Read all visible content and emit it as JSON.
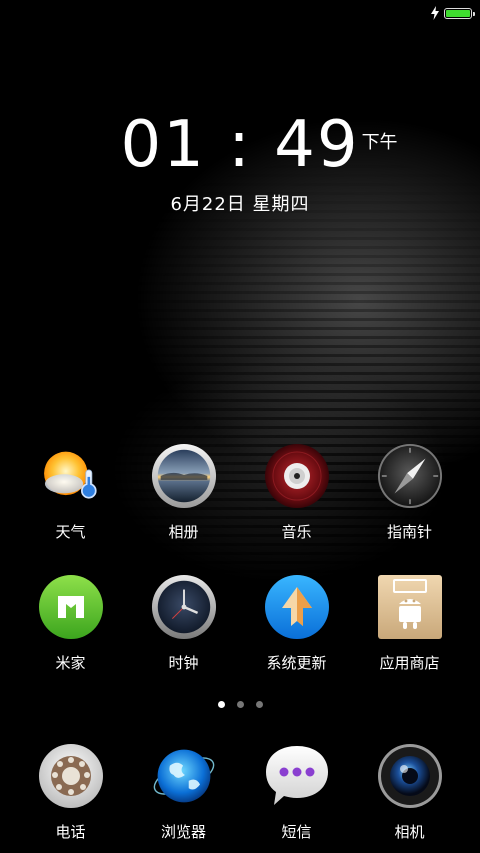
{
  "status_bar": {
    "battery_level": 1.0,
    "charging": true,
    "battery_color": "#3fdc2f"
  },
  "lock": {
    "time": "01 : 49",
    "ampm": "下午",
    "date": "6月22日  星期四"
  },
  "row1": [
    {
      "label": "天气",
      "icon": "weather-icon"
    },
    {
      "label": "相册",
      "icon": "gallery-icon"
    },
    {
      "label": "音乐",
      "icon": "music-icon"
    },
    {
      "label": "指南针",
      "icon": "compass-icon"
    }
  ],
  "row2": [
    {
      "label": "米家",
      "icon": "mijia-icon"
    },
    {
      "label": "时钟",
      "icon": "clock-icon"
    },
    {
      "label": "系统更新",
      "icon": "system-update-icon"
    },
    {
      "label": "应用商店",
      "icon": "app-store-icon"
    }
  ],
  "dock": [
    {
      "label": "电话",
      "icon": "phone-icon"
    },
    {
      "label": "浏览器",
      "icon": "browser-icon"
    },
    {
      "label": "短信",
      "icon": "messages-icon"
    },
    {
      "label": "相机",
      "icon": "camera-icon"
    }
  ],
  "pages": {
    "count": 3,
    "active": 1
  }
}
